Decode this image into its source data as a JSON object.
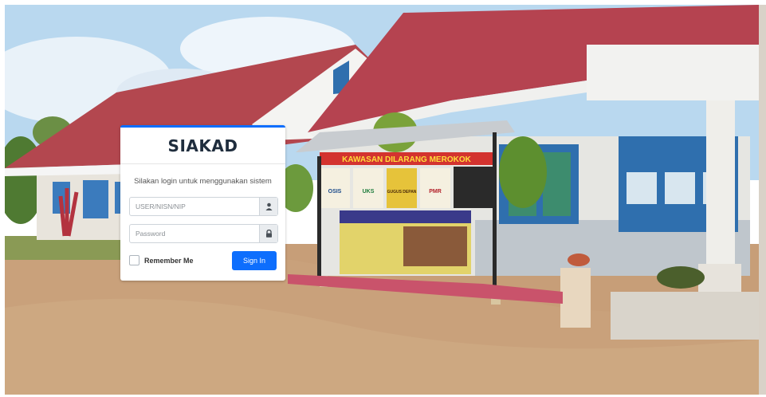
{
  "login": {
    "title": "SIAKAD",
    "message": "Silakan login untuk menggunakan sistem",
    "username_placeholder": "USER/NISN/NIP",
    "password_placeholder": "Password",
    "remember_label": "Remember Me",
    "signin_label": "Sign In",
    "accent_color": "#0d6efd",
    "icons": {
      "username": "user-icon",
      "password": "lock-icon"
    }
  },
  "background": {
    "banner_main": "KAWASAN DILARANG MEROKOK",
    "banner_signs": [
      "OSIS",
      "UKS",
      "GUGUS DEPAN",
      "PMR"
    ]
  }
}
